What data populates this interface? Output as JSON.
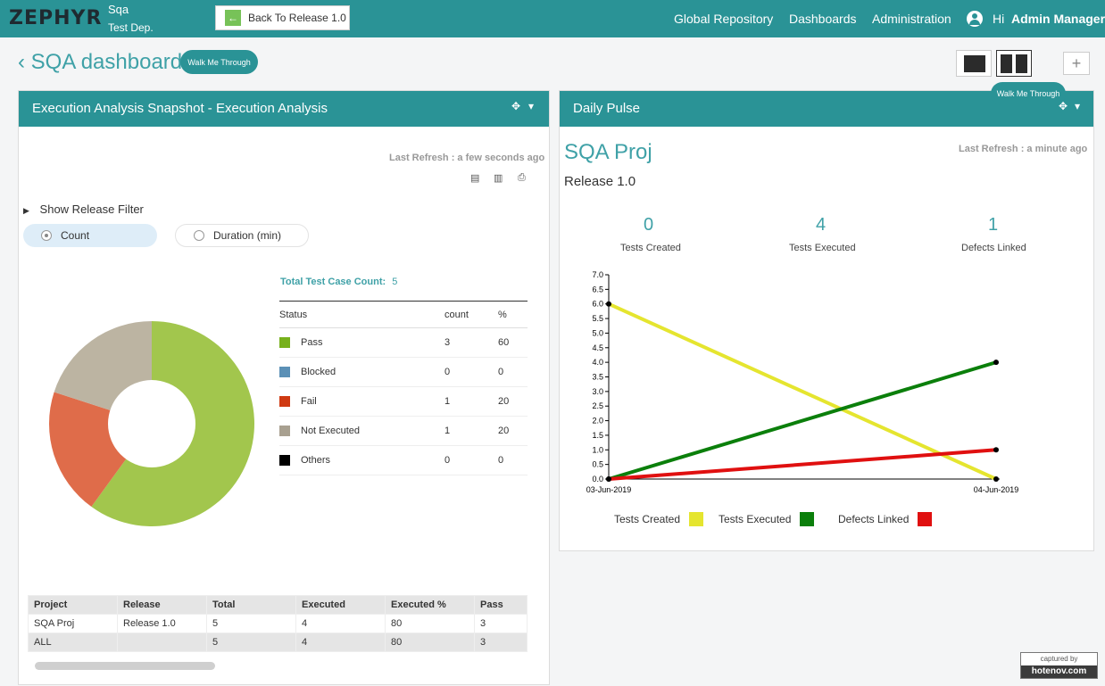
{
  "topbar": {
    "logo": "ZEPHYR",
    "project": "Sqa",
    "department": "Test Dep.",
    "back_button": "Back To Release 1.0",
    "nav": [
      "Global Repository",
      "Dashboards",
      "Administration"
    ],
    "greeting": "Hi",
    "user": "Admin Manager"
  },
  "page": {
    "title": "SQA dashboard",
    "walk_through": "Walk Me Through",
    "add_label": "+"
  },
  "panel_left": {
    "title": "Execution Analysis Snapshot - Execution Analysis",
    "last_refresh": "Last Refresh : a few seconds ago",
    "filter_toggle": "Show Release Filter",
    "radio_count": "Count",
    "radio_duration": "Duration (min)",
    "total_label": "Total Test Case Count:",
    "total_value": "5",
    "table_headers": [
      "Status",
      "count",
      "%"
    ],
    "rows": [
      {
        "status": "Pass",
        "count": "3",
        "pct": "60",
        "color": "#77b11c"
      },
      {
        "status": "Blocked",
        "count": "0",
        "pct": "0",
        "color": "#5b90b6"
      },
      {
        "status": "Fail",
        "count": "1",
        "pct": "20",
        "color": "#cf3a12"
      },
      {
        "status": "Not Executed",
        "count": "1",
        "pct": "20",
        "color": "#a8a090"
      },
      {
        "status": "Others",
        "count": "0",
        "pct": "0",
        "color": "#000000"
      }
    ],
    "summary_headers": [
      "Project",
      "Release",
      "Total",
      "Executed",
      "Executed %",
      "Pass"
    ],
    "summary_rows": [
      [
        "SQA Proj",
        "Release 1.0",
        "5",
        "4",
        "80",
        "3"
      ],
      [
        "ALL",
        "",
        "5",
        "4",
        "80",
        "3"
      ]
    ]
  },
  "panel_right": {
    "title": "Daily Pulse",
    "walk_through": "Walk Me Through",
    "project": "SQA Proj",
    "release": "Release 1.0",
    "last_refresh": "Last Refresh : a minute ago",
    "stats": [
      {
        "value": "0",
        "label": "Tests Created"
      },
      {
        "value": "4",
        "label": "Tests Executed"
      },
      {
        "value": "1",
        "label": "Defects Linked"
      }
    ]
  },
  "chart_data": [
    {
      "type": "pie",
      "categories": [
        "Pass",
        "Fail",
        "Not Executed"
      ],
      "values": [
        3,
        1,
        1
      ],
      "colors": [
        "#a2c64d",
        "#df6c4a",
        "#bcb4a2"
      ],
      "donut": true
    },
    {
      "type": "line",
      "x": [
        "03-Jun-2019",
        "04-Jun-2019"
      ],
      "ylim": [
        0,
        7
      ],
      "yticks": [
        "0.0",
        "0.5",
        "1.0",
        "1.5",
        "2.0",
        "2.5",
        "3.0",
        "3.5",
        "4.0",
        "4.5",
        "5.0",
        "5.5",
        "6.0",
        "6.5",
        "7.0"
      ],
      "series": [
        {
          "name": "Tests Created",
          "values": [
            6,
            0
          ],
          "color": "#e5e52f"
        },
        {
          "name": "Tests Executed",
          "values": [
            0,
            4
          ],
          "color": "#0b7f0b"
        },
        {
          "name": "Defects Linked",
          "values": [
            0,
            1
          ],
          "color": "#e01010"
        }
      ],
      "legend": "bottom"
    }
  ],
  "watermark": {
    "top": "captured by",
    "bottom": "hotenov.com"
  }
}
